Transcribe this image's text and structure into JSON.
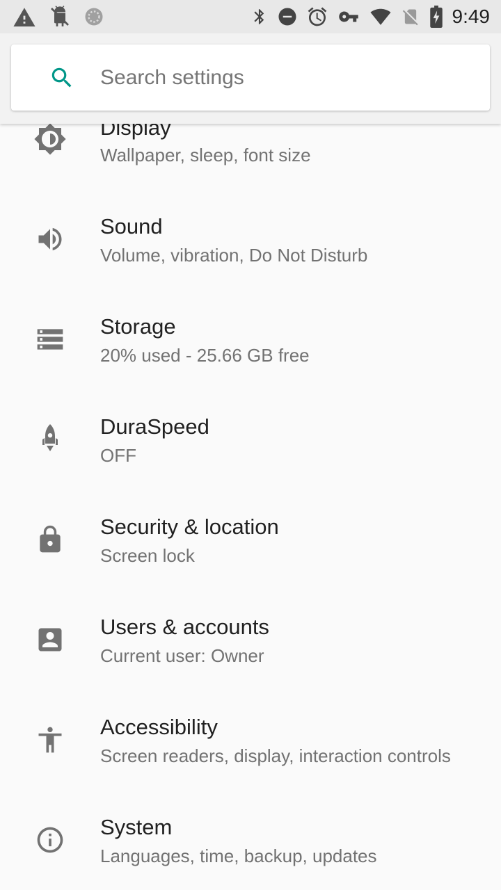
{
  "status_bar": {
    "time": "9:49",
    "left_icons": [
      "warning-icon",
      "android-debug-icon",
      "sync-circle-icon"
    ],
    "right_icons": [
      "bluetooth-icon",
      "do-not-disturb-icon",
      "alarm-icon",
      "vpn-key-icon",
      "wifi-icon",
      "no-sim-icon",
      "battery-charging-icon"
    ]
  },
  "search": {
    "placeholder": "Search settings",
    "accent_color": "#009688"
  },
  "settings_items": [
    {
      "title": "Display",
      "summary": "Wallpaper, sleep, font size",
      "icon": "brightness-icon"
    },
    {
      "title": "Sound",
      "summary": "Volume, vibration, Do Not Disturb",
      "icon": "volume-icon"
    },
    {
      "title": "Storage",
      "summary": "20% used - 25.66 GB free",
      "icon": "storage-icon"
    },
    {
      "title": "DuraSpeed",
      "summary": "OFF",
      "icon": "rocket-icon"
    },
    {
      "title": "Security & location",
      "summary": "Screen lock",
      "icon": "lock-icon"
    },
    {
      "title": "Users & accounts",
      "summary": "Current user: Owner",
      "icon": "account-box-icon"
    },
    {
      "title": "Accessibility",
      "summary": "Screen readers, display, interaction controls",
      "icon": "accessibility-icon"
    },
    {
      "title": "System",
      "summary": "Languages, time, backup, updates",
      "icon": "info-icon"
    }
  ]
}
